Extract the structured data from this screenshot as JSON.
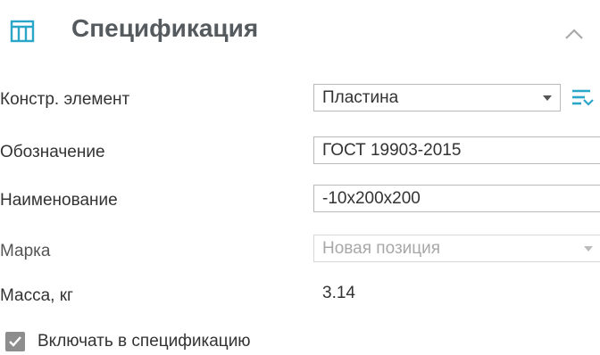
{
  "header": {
    "title": "Спецификация",
    "accent_color": "#2aa6c9",
    "icon": "table-icon",
    "collapse_icon": "chevron-up-icon"
  },
  "form": {
    "element": {
      "label": "Констр. элемент",
      "value": "Пластина",
      "action_icon": "filter-list-icon"
    },
    "designation": {
      "label": "Обозначение",
      "value": "ГОСТ 19903-2015"
    },
    "name": {
      "label": "Наименование",
      "value": "-10x200x200"
    },
    "mark": {
      "label": "Марка",
      "placeholder": "Новая позиция"
    },
    "mass": {
      "label": "Масса, кг",
      "value": "3.14"
    }
  },
  "include_in_spec": {
    "label": "Включать в спецификацию",
    "checked": true
  }
}
